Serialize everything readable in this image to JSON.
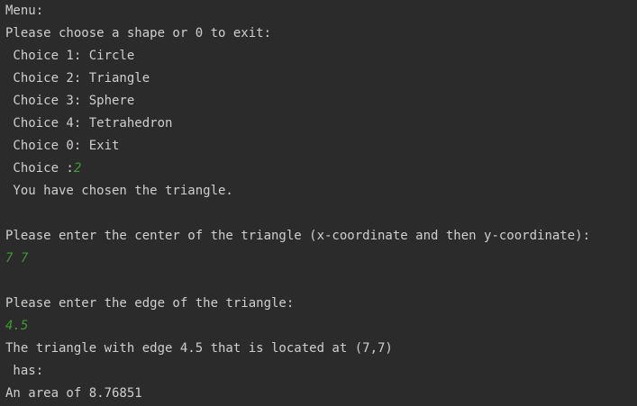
{
  "console": {
    "menu_title": "Menu:",
    "prompt_shape": "Please choose a shape or 0 to exit:",
    "choices": [
      " Choice 1: Circle",
      " Choice 2: Triangle",
      " Choice 3: Sphere",
      " Choice 4: Tetrahedron",
      " Choice 0: Exit"
    ],
    "choice_prompt": " Choice :",
    "choice_input": "2",
    "chosen_message": " You have chosen the triangle.",
    "center_prompt": "Please enter the center of the triangle (x-coordinate and then y-coordinate):",
    "center_input": "7 7",
    "edge_prompt": "Please enter the edge of the triangle:",
    "edge_input": "4.5",
    "result_line1": "The triangle with edge 4.5 that is located at (7,7)",
    "result_line2": " has:",
    "result_line3": "An area of 8.76851"
  },
  "colors": {
    "background": "#2b2b2b",
    "text": "#cfcfcf",
    "user_input": "#3f9b35"
  }
}
